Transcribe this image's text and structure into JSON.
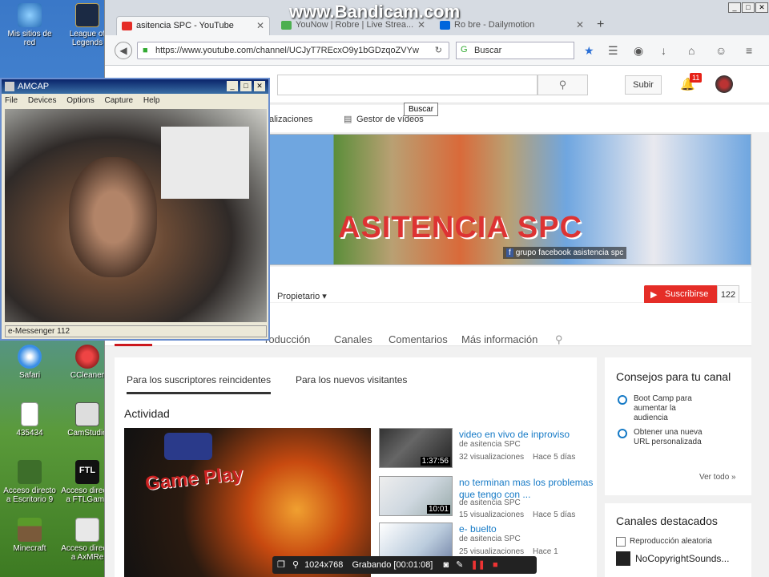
{
  "watermark": "www.Bandicam.com",
  "desktop_icons": [
    {
      "label": "Mis sitios de red"
    },
    {
      "label": "League of Legends"
    },
    {
      "label": "Safari"
    },
    {
      "label": "CCleaner"
    },
    {
      "label": "435434"
    },
    {
      "label": "CamStudio"
    },
    {
      "label": "Acceso directo a Escritorio 9"
    },
    {
      "label": "Acceso directo a FTLGame"
    },
    {
      "label": "Minecraft"
    },
    {
      "label": "Acceso directo a AxMRe"
    }
  ],
  "browser": {
    "tabs": [
      {
        "label": "asitencia SPC - YouTube"
      },
      {
        "label": "YouNow | Robre | Live Strea..."
      },
      {
        "label": "Ro bre - Dailymotion"
      }
    ],
    "url": "https://www.youtube.com/channel/UCJyT7REcxO9y1bGDzqoZVYw",
    "search_placeholder": "Buscar"
  },
  "youtube": {
    "tooltip": "Buscar",
    "upload_label": "Subir",
    "notification_count": "11",
    "subheader_links": [
      "alizaciones",
      "Gestor de vídeos"
    ],
    "banner_text": "ASITENCIA SPC",
    "banner_fb": "grupo facebook asistencia spc",
    "owner_label": "Propietario",
    "subscribe_label": "Suscribirse",
    "subscriber_count": "122",
    "channel_tabs": [
      "roducción",
      "Canales",
      "Comentarios",
      "Más información"
    ],
    "feed_tabs": [
      "Para los suscriptores reincidentes",
      "Para los nuevos visitantes"
    ],
    "activity_heading": "Actividad",
    "big_video_text": "Game Play",
    "videos": [
      {
        "title": "video en vivo de inproviso",
        "by": "de asitencia SPC",
        "views": "32 visualizaciones",
        "age": "Hace 5 días",
        "duration": "1:37:56"
      },
      {
        "title": "no terminan mas los problemas que tengo con ...",
        "by": "de asitencia SPC",
        "views": "15 visualizaciones",
        "age": "Hace 5 días",
        "duration": "10:01"
      },
      {
        "title": "e- buelto",
        "by": "de asitencia SPC",
        "views": "25 visualizaciones",
        "age": "Hace 1",
        "duration": ""
      }
    ],
    "tips": {
      "heading": "Consejos para tu canal",
      "items": [
        "Boot Camp para aumentar la audiencia",
        "Obtener una nueva URL personalizada"
      ],
      "see_all": "Ver todo"
    },
    "featured": {
      "heading": "Canales destacados",
      "autoplay_label": "Reproducción aleatoria",
      "channel": "NoCopyrightSounds..."
    }
  },
  "amcap": {
    "title": "AMCAP",
    "menu": [
      "File",
      "Devices",
      "Options",
      "Capture",
      "Help"
    ],
    "status": "e-Messenger 112"
  },
  "bandicam_bar": {
    "resolution": "1024x768",
    "recording": "Grabando [00:01:08]"
  }
}
